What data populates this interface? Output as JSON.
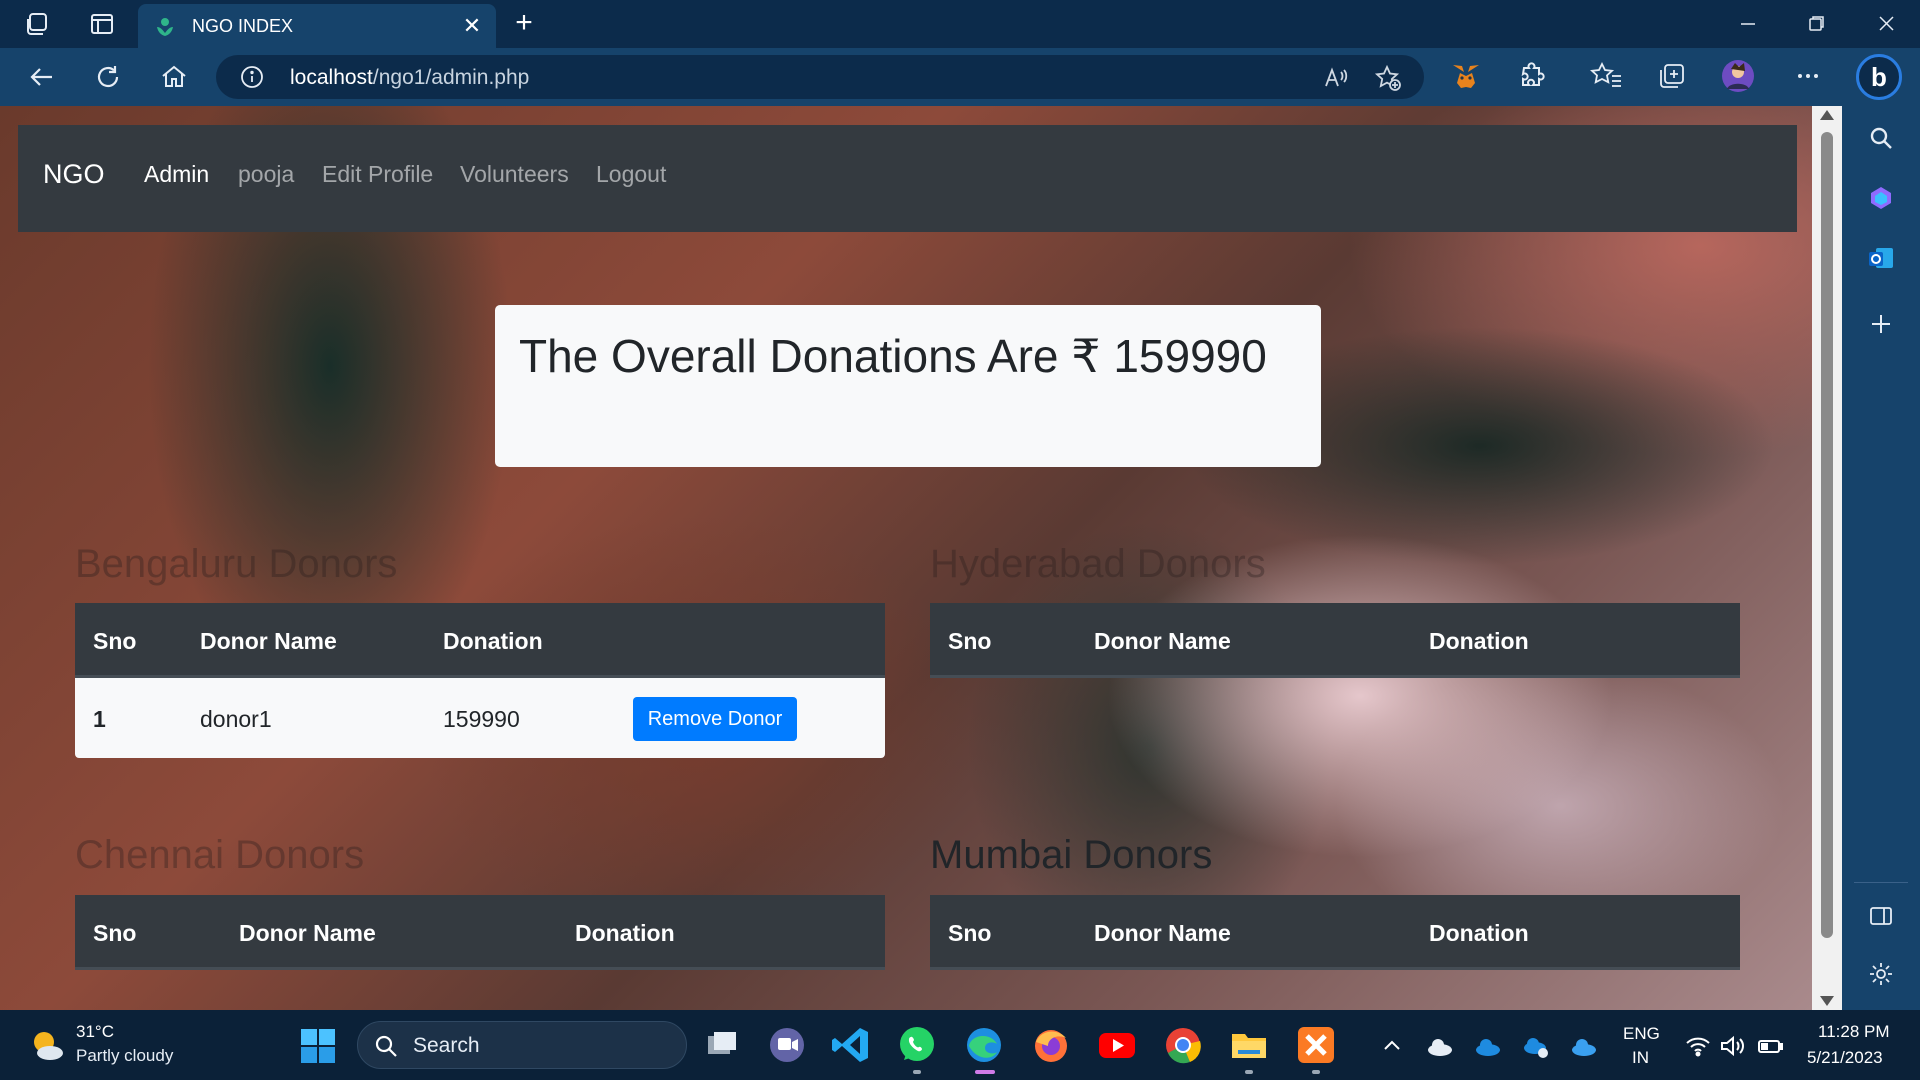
{
  "browser": {
    "tab_title": "NGO INDEX",
    "url_host": "localhost",
    "url_path": "/ngo1/admin.php"
  },
  "navbar": {
    "brand": "NGO",
    "links": [
      "Admin",
      "pooja",
      "Edit Profile",
      "Volunteers",
      "Logout"
    ]
  },
  "summary": {
    "text": "The Overall Donations Are ₹ 159990"
  },
  "donor_tables": {
    "headers": {
      "sno": "Sno",
      "name": "Donor Name",
      "donation": "Donation"
    },
    "bengaluru": {
      "title": "Bengaluru Donors",
      "rows": [
        {
          "sno": "1",
          "name": "donor1",
          "donation": "159990",
          "action": "Remove Donor"
        }
      ]
    },
    "hyderabad": {
      "title": "Hyderabad Donors",
      "rows": []
    },
    "chennai": {
      "title": "Chennai Donors",
      "rows": []
    },
    "mumbai": {
      "title": "Mumbai Donors",
      "rows": []
    }
  },
  "taskbar": {
    "weather_temp": "31°C",
    "weather_desc": "Partly cloudy",
    "search_label": "Search",
    "lang_line1": "ENG",
    "lang_line2": "IN",
    "time": "11:28 PM",
    "date": "5/21/2023"
  },
  "colors": {
    "navbar_bg": "#343a40",
    "primary_button": "#007bff",
    "browser_frame": "#16436b"
  }
}
